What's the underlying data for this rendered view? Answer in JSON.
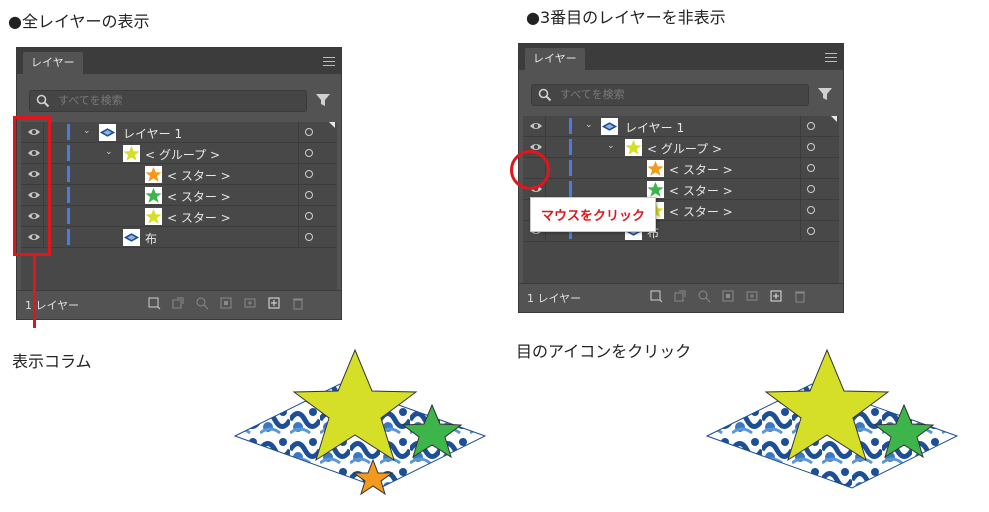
{
  "left": {
    "caption": "●全レイヤーの表示",
    "panel": {
      "tab": "レイヤー",
      "search_placeholder": "すべてを検索",
      "layers": [
        {
          "label": "レイヤー 1",
          "twisty": "⌄",
          "visible": true
        },
        {
          "label": "< グループ >",
          "twisty": "⌄",
          "visible": true
        },
        {
          "label": "< スター >",
          "visible": true
        },
        {
          "label": "< スター >",
          "visible": true
        },
        {
          "label": "< スター >",
          "visible": true
        },
        {
          "label": "布",
          "visible": true
        }
      ],
      "footer_count": "1 レイヤー"
    },
    "annotation": "表示コラム"
  },
  "right": {
    "caption": "●3番目のレイヤーを非表示",
    "panel": {
      "tab": "レイヤー",
      "search_placeholder": "すべてを検索",
      "layers": [
        {
          "label": "レイヤー 1",
          "twisty": "⌄",
          "visible": true
        },
        {
          "label": "< グループ >",
          "twisty": "⌄",
          "visible": true
        },
        {
          "label": "< スター >",
          "visible": false
        },
        {
          "label": "< スター >",
          "visible": true
        },
        {
          "label": "< スター >",
          "visible": true
        },
        {
          "label": "布",
          "visible": true
        }
      ],
      "footer_count": "1 レイヤー"
    },
    "tooltip": "マウスをクリック",
    "annotation": "目のアイコンをクリック"
  },
  "colors": {
    "panel_bg": "#535353",
    "list_bg": "#484848",
    "layer_bar": "#4a7be0",
    "highlight": "#e0161c",
    "star_yellow": "#d6df27",
    "star_green": "#3db54a",
    "star_orange": "#f39a1e",
    "cloth_blue": "#1c4f95"
  },
  "icons": [
    "eye-icon",
    "search-icon",
    "filter-icon",
    "panel-menu-icon",
    "target-circle-icon",
    "new-layer-icon",
    "delete-icon"
  ]
}
